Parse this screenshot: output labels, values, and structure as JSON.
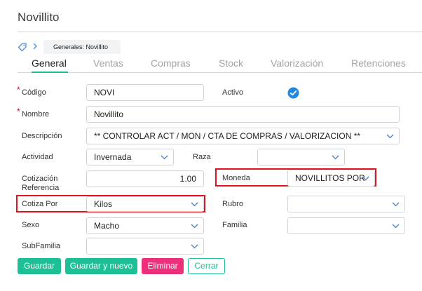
{
  "header": {
    "title": "Novillito"
  },
  "breadcrumb": {
    "current": "Generales: Novillito"
  },
  "tabs": [
    {
      "label": "General",
      "active": true
    },
    {
      "label": "Ventas",
      "active": false
    },
    {
      "label": "Compras",
      "active": false
    },
    {
      "label": "Stock",
      "active": false
    },
    {
      "label": "Valorización",
      "active": false
    },
    {
      "label": "Retenciones",
      "active": false
    }
  ],
  "form": {
    "codigo": {
      "label": "Código",
      "value": "NOVI",
      "required": true
    },
    "activo": {
      "label": "Activo",
      "checked": true
    },
    "nombre": {
      "label": "Nombre",
      "value": "Novillito",
      "required": true
    },
    "descripcion": {
      "label": "Descripción",
      "value": "** CONTROLAR ACT / MON /  CTA DE COMPRAS  / VALORIZACION **"
    },
    "actividad": {
      "label": "Actividad",
      "value": "Invernada"
    },
    "raza": {
      "label": "Raza",
      "value": ""
    },
    "cotizacion": {
      "label_line1": "Cotización",
      "label_line2": "Referencia",
      "value": "1.00"
    },
    "moneda": {
      "label": "Moneda",
      "value": "NOVILLITOS POR"
    },
    "cotiza_por": {
      "label": "Cotiza Por",
      "value": "Kilos"
    },
    "rubro": {
      "label": "Rubro",
      "value": ""
    },
    "sexo": {
      "label": "Sexo",
      "value": "Macho"
    },
    "familia": {
      "label": "Familia",
      "value": ""
    },
    "subfamilia": {
      "label": "SubFamilia",
      "value": ""
    }
  },
  "actions": {
    "guardar": "Guardar",
    "guardar_nuevo": "Guardar y nuevo",
    "eliminar": "Eliminar",
    "cerrar": "Cerrar"
  },
  "colors": {
    "accent": "#1dbf95",
    "danger": "#ee2f7b",
    "highlight": "#e0141f",
    "check": "#1e88e5"
  }
}
